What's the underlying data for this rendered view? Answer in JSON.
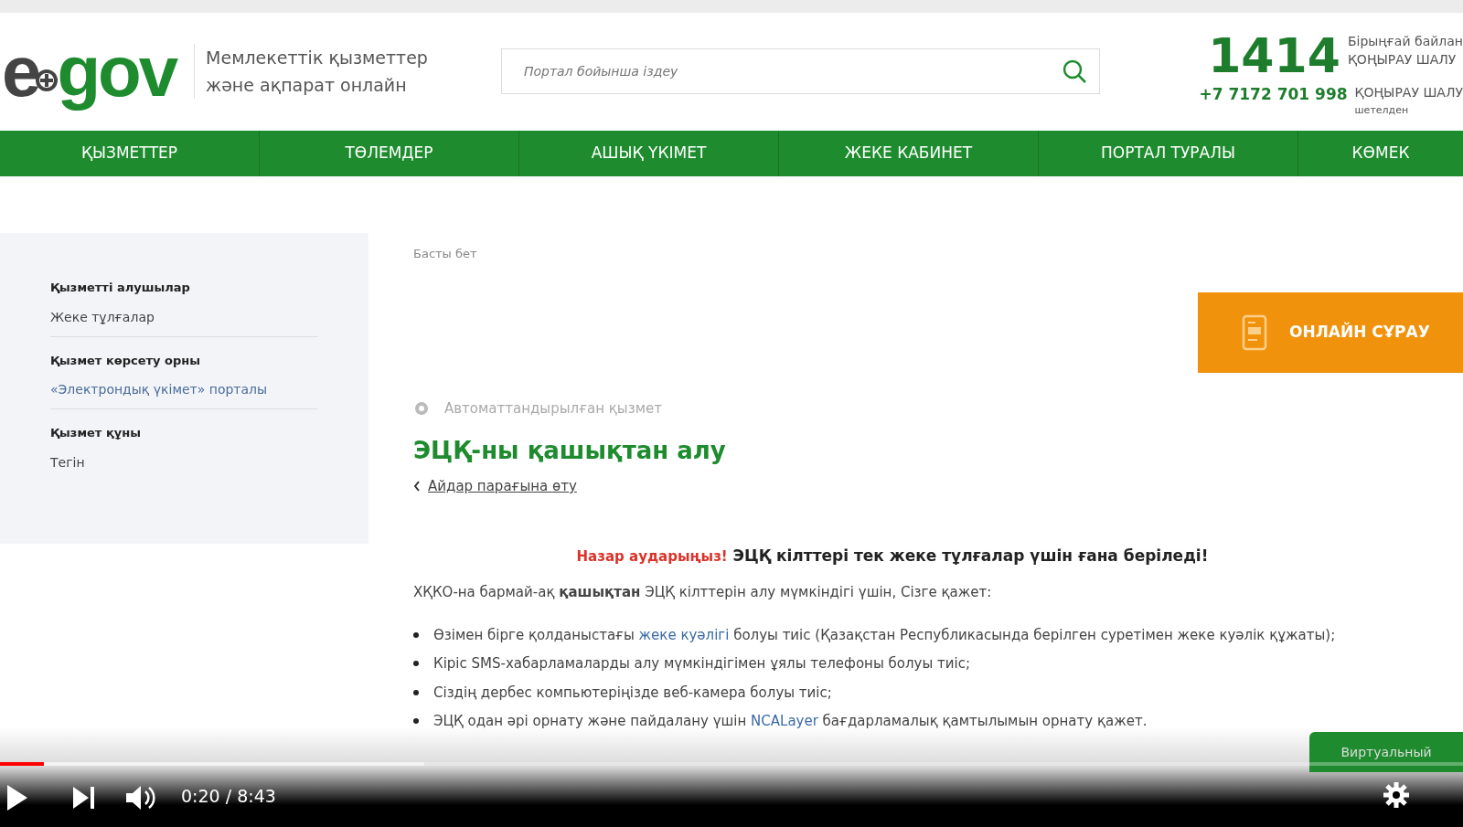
{
  "header": {
    "logo": "e",
    "logo_rest": "gov",
    "tagline": [
      "Мемлекеттік қызметтер",
      "және ақпарат онлайн"
    ],
    "search": {
      "placeholder": "Портал бойынша іздеу"
    },
    "contacts": [
      {
        "number": "1414",
        "lines": [
          "Бірыңғай байлан",
          "ҚОҢЫРАУ ШАЛУ"
        ]
      },
      {
        "number": "+7 7172 701 998",
        "lines": [
          "ҚОҢЫРАУ ШАЛУ",
          "шетелден"
        ]
      }
    ]
  },
  "nav": [
    "ҚЫЗМЕТТЕР",
    "ТӨЛЕМДЕР",
    "АШЫҚ ҮКІМЕТ",
    "ЖЕКЕ КАБИНЕТ",
    "ПОРТАЛ ТУРАЛЫ",
    "КӨМЕК"
  ],
  "sidebar": [
    {
      "heading": "Қызметті алушылар",
      "value": "Жеке тұлғалар",
      "kind": "text"
    },
    {
      "heading": "Қызмет көрсету орны",
      "value": "«Электрондық үкімет» порталы",
      "kind": "link"
    },
    {
      "heading": "Қызмет құны",
      "value": "Тегін",
      "kind": "text"
    }
  ],
  "breadcrumb": "Басты бет",
  "online_button": "ОНЛАЙН СҰРАУ",
  "service_type": "Автоматтандырылған қызмет",
  "title": "ЭЦҚ-ны қашықтан алу",
  "back_link": "Айдар парағына өту",
  "notice": {
    "label": "Назар аударыңыз!",
    "text": "ЭЦҚ кілттері тек жеке тұлғалар үшін ғана беріледі!"
  },
  "intro": "ХҚКО-на бармай-ақ **қашықтан** ЭЦҚ кілттерін алу мүмкіндігі үшін, Сізге қажет:",
  "requirements": [
    [
      {
        "kind": "plain",
        "text": "Өзімен бірге қолданыстағы "
      },
      {
        "kind": "link",
        "text": "жеке куәлігі"
      },
      {
        "kind": "plain",
        "text": " болуы тиіс (Қазақстан Республикасында берілген суретімен жеке куәлік құжаты);"
      }
    ],
    [
      {
        "kind": "plain",
        "text": "Кіріс SMS-хабарламаларды алу мүмкіндігімен ұялы телефоны болуы тиіс;"
      }
    ],
    [
      {
        "kind": "plain",
        "text": "Сіздің дербес компьютеріңізде веб-камера болуы тиіс;"
      }
    ],
    [
      {
        "kind": "plain",
        "text": "ЭЦҚ одан әрі орнату және пайдалану үшін "
      },
      {
        "kind": "link",
        "text": "NCALayer"
      },
      {
        "kind": "plain",
        "text": " бағдарламалық қамтылымын орнату қажет."
      }
    ]
  ],
  "virtual_button": "Виртуальный",
  "player": {
    "time": "0:20 / 8:43",
    "progress": {
      "level": 0.03
    },
    "buffer": {
      "level": 0.29
    }
  }
}
